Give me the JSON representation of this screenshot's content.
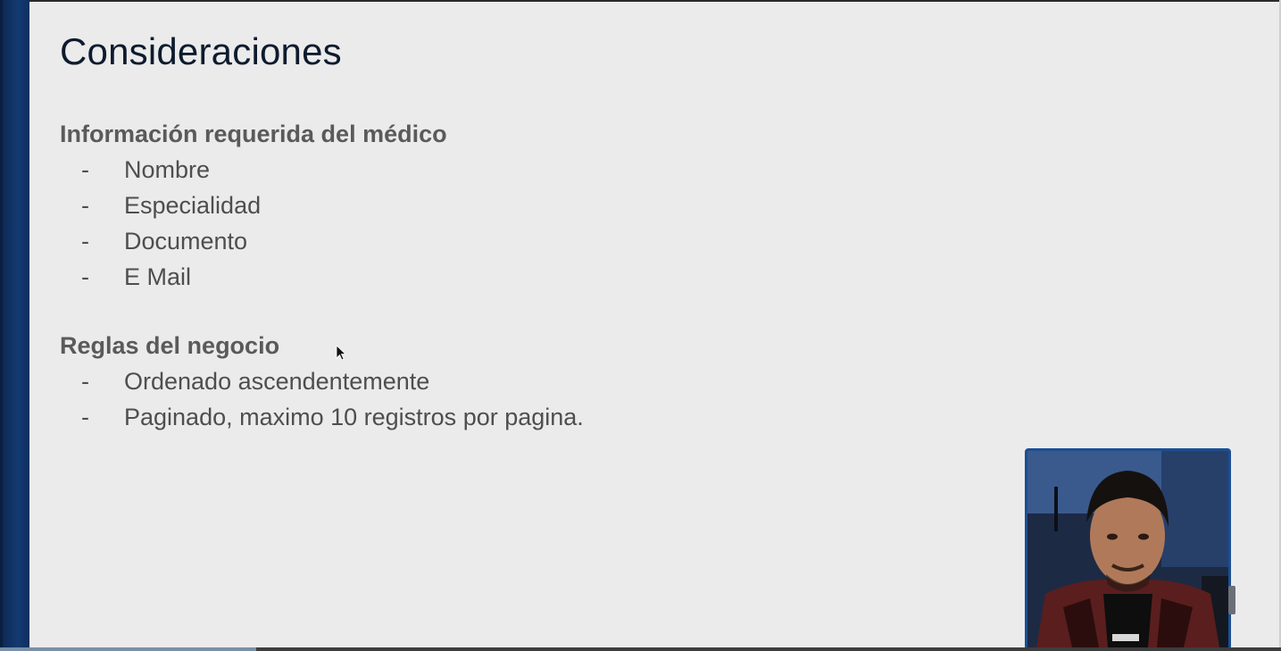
{
  "slide": {
    "title": "Consideraciones",
    "sections": [
      {
        "heading": "Información requerida del médico",
        "items": [
          "Nombre",
          "Especialidad",
          "Documento",
          "E Mail"
        ]
      },
      {
        "heading": "Reglas del negocio",
        "items": [
          "Ordenado ascendentemente",
          "Paginado, maximo 10 registros por pagina."
        ]
      }
    ],
    "bullet_marker": "-"
  },
  "player": {
    "progress_fraction": 0.2
  },
  "colors": {
    "accent_bar": "#133a72",
    "background": "#ebebeb",
    "title": "#0e1b2e",
    "body_text": "#4e4e4e",
    "webcam_border": "#1b4f94"
  }
}
